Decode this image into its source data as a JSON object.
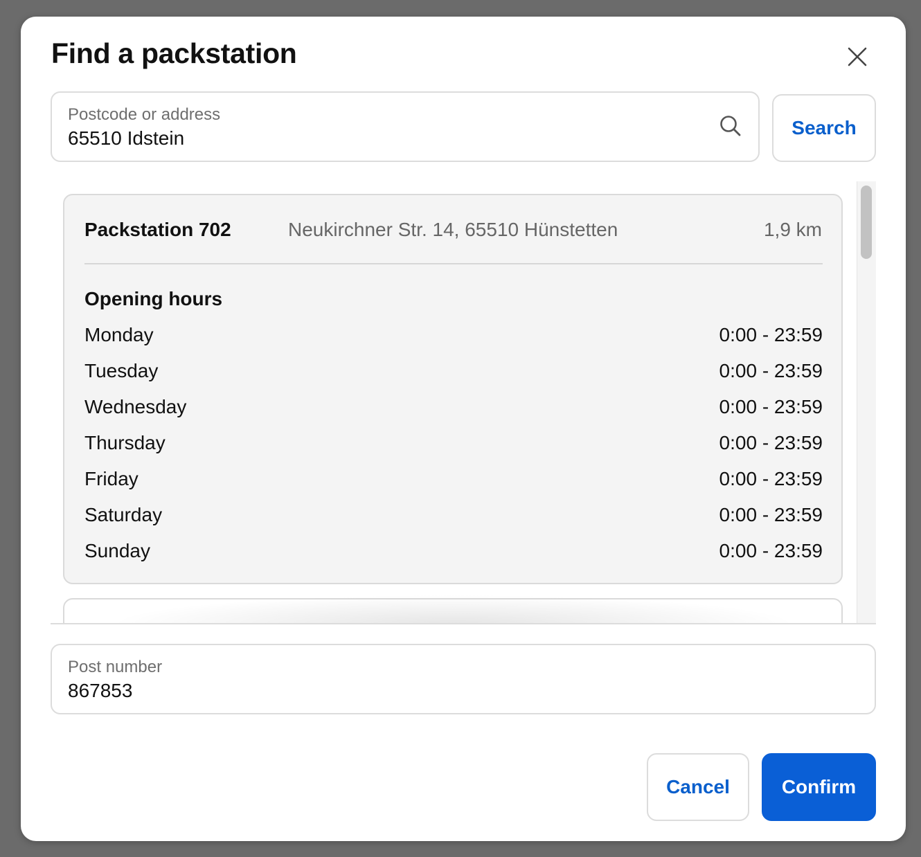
{
  "dialog": {
    "title": "Find a packstation",
    "close_icon": "close-icon"
  },
  "search": {
    "label": "Postcode or address",
    "value": "65510 Idstein",
    "icon": "search-icon",
    "button_label": "Search"
  },
  "results": [
    {
      "name": "Packstation 702",
      "address": "Neukirchner Str. 14, 65510 Hünstetten",
      "distance": "1,9 km",
      "hours_heading": "Opening hours",
      "hours": [
        {
          "day": "Monday",
          "time": "0:00 - 23:59"
        },
        {
          "day": "Tuesday",
          "time": "0:00 - 23:59"
        },
        {
          "day": "Wednesday",
          "time": "0:00 - 23:59"
        },
        {
          "day": "Thursday",
          "time": "0:00 - 23:59"
        },
        {
          "day": "Friday",
          "time": "0:00 - 23:59"
        },
        {
          "day": "Saturday",
          "time": "0:00 - 23:59"
        },
        {
          "day": "Sunday",
          "time": "0:00 - 23:59"
        }
      ]
    }
  ],
  "post_number": {
    "label": "Post number",
    "value": "867853"
  },
  "footer": {
    "cancel_label": "Cancel",
    "confirm_label": "Confirm"
  },
  "colors": {
    "accent": "#0a5fd6",
    "card_background": "#f4f4f4",
    "overlay": "#6b6b6b"
  }
}
